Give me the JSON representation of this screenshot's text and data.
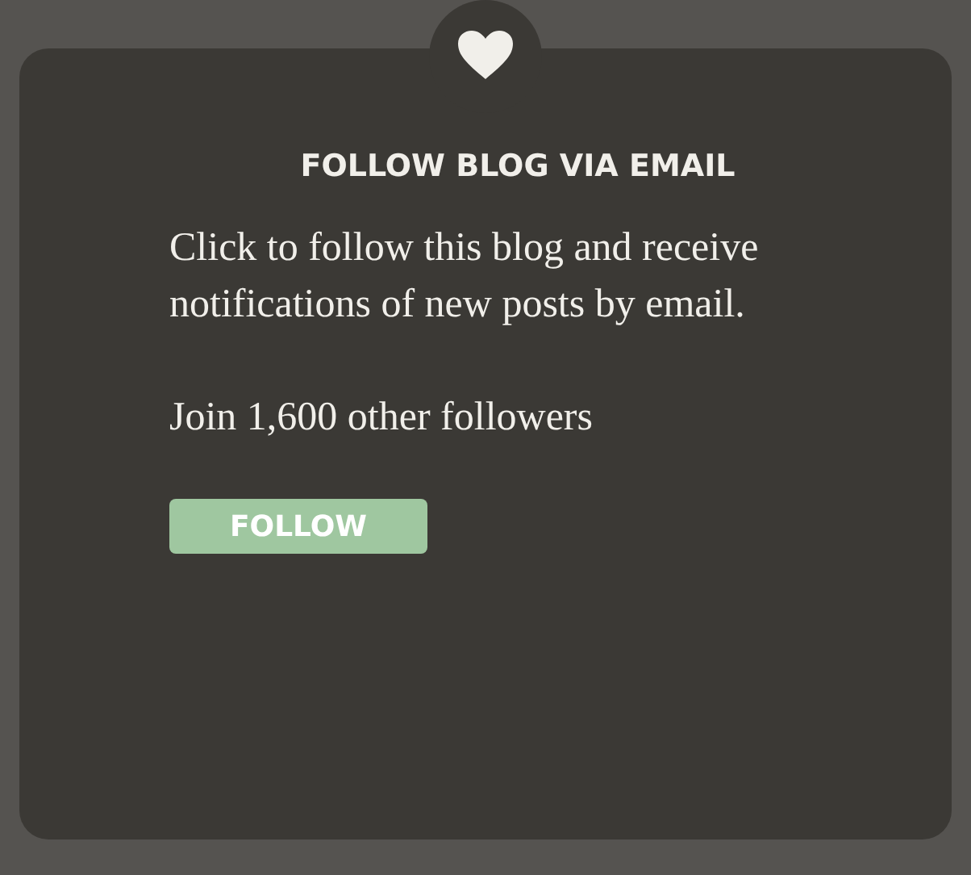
{
  "widget": {
    "title": "FOLLOW BLOG VIA EMAIL",
    "description": "Click to follow this blog and receive notifications of new posts by email.",
    "followers": "Join 1,600 other followers",
    "button": "FOLLOW"
  }
}
